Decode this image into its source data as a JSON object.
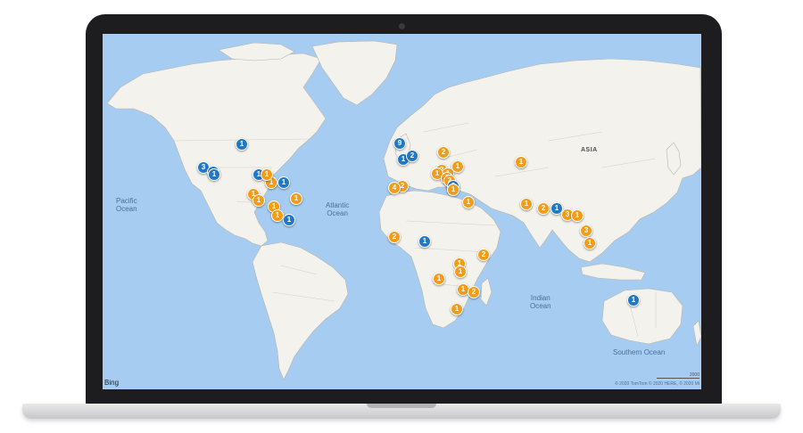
{
  "map": {
    "labels": {
      "pacific": "Pacific\nOcean",
      "atlantic": "Atlantic\nOcean",
      "indian": "Indian\nOcean",
      "southern": "Southern Ocean",
      "asia": "ASIA"
    },
    "markers": [
      {
        "count": "1",
        "color": "blue"
      },
      {
        "count": "3",
        "color": "blue"
      },
      {
        "count": "1",
        "color": "blue"
      },
      {
        "count": "1",
        "color": "blue"
      },
      {
        "count": "1",
        "color": "orange"
      },
      {
        "count": "1",
        "color": "blue"
      },
      {
        "count": "1",
        "color": "orange"
      },
      {
        "count": "1",
        "color": "orange"
      },
      {
        "count": "1",
        "color": "orange"
      },
      {
        "count": "1",
        "color": "orange"
      },
      {
        "count": "1",
        "color": "blue"
      },
      {
        "count": "1",
        "color": "orange"
      },
      {
        "count": "1",
        "color": "orange"
      },
      {
        "count": "1",
        "color": "blue"
      },
      {
        "count": "1",
        "color": "blue"
      },
      {
        "count": "9",
        "color": "blue"
      },
      {
        "count": "2",
        "color": "blue"
      },
      {
        "count": "1",
        "color": "blue"
      },
      {
        "count": "2",
        "color": "orange"
      },
      {
        "count": "2",
        "color": "orange"
      },
      {
        "count": "1",
        "color": "orange"
      },
      {
        "count": "1",
        "color": "orange"
      },
      {
        "count": "1",
        "color": "orange"
      },
      {
        "count": "1",
        "color": "orange"
      },
      {
        "count": "2",
        "color": "orange"
      },
      {
        "count": "2",
        "color": "blue"
      },
      {
        "count": "1",
        "color": "orange"
      },
      {
        "count": "2",
        "color": "orange"
      },
      {
        "count": "4",
        "color": "orange"
      },
      {
        "count": "1",
        "color": "orange"
      },
      {
        "count": "1",
        "color": "orange"
      },
      {
        "count": "1",
        "color": "orange"
      },
      {
        "count": "2",
        "color": "orange"
      },
      {
        "count": "1",
        "color": "blue"
      },
      {
        "count": "3",
        "color": "orange"
      },
      {
        "count": "1",
        "color": "orange"
      },
      {
        "count": "2",
        "color": "orange"
      },
      {
        "count": "1",
        "color": "blue"
      },
      {
        "count": "1",
        "color": "orange"
      },
      {
        "count": "1",
        "color": "orange"
      },
      {
        "count": "2",
        "color": "orange"
      },
      {
        "count": "1",
        "color": "orange"
      },
      {
        "count": "1",
        "color": "orange"
      },
      {
        "count": "2",
        "color": "orange"
      },
      {
        "count": "1",
        "color": "orange"
      },
      {
        "count": "3",
        "color": "orange"
      },
      {
        "count": "1",
        "color": "orange"
      },
      {
        "count": "1",
        "color": "blue"
      }
    ]
  },
  "footer": {
    "bing": "Bing",
    "copyright": "© 2020 TomTom © 2020 HERE, © 2020 Mi",
    "scale": "2000"
  },
  "colors": {
    "ocean": "#a6cdf1",
    "land": "#f4f2ec",
    "marker_orange": "#f39c18",
    "marker_blue": "#1f78c8"
  }
}
